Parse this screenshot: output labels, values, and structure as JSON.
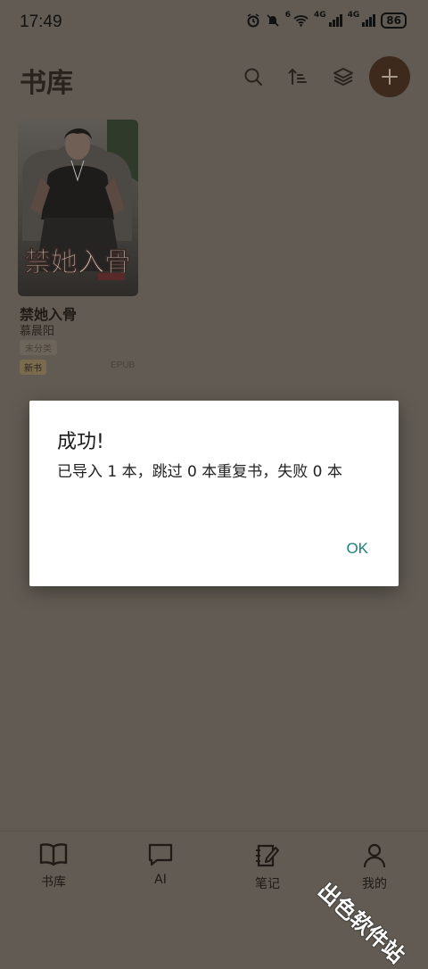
{
  "status_bar": {
    "time": "17:49",
    "battery": "86",
    "net1": "6",
    "net2": "4G",
    "net3": "4G"
  },
  "header": {
    "title": "书库"
  },
  "book": {
    "title": "禁她入骨",
    "author": "慕晨阳",
    "category": "未分类",
    "tag": "新书",
    "format": "EPUB",
    "cover_text": "禁她入骨"
  },
  "dialog": {
    "title": "成功!",
    "message": "已导入 1 本，跳过 0 本重复书，失败 0 本",
    "ok": "OK"
  },
  "nav": [
    {
      "label": "书库",
      "icon": "book-open-icon"
    },
    {
      "label": "AI",
      "icon": "chat-bubble-icon"
    },
    {
      "label": "笔记",
      "icon": "notebook-icon"
    },
    {
      "label": "我的",
      "icon": "person-icon"
    }
  ],
  "watermark": "出色软件站"
}
